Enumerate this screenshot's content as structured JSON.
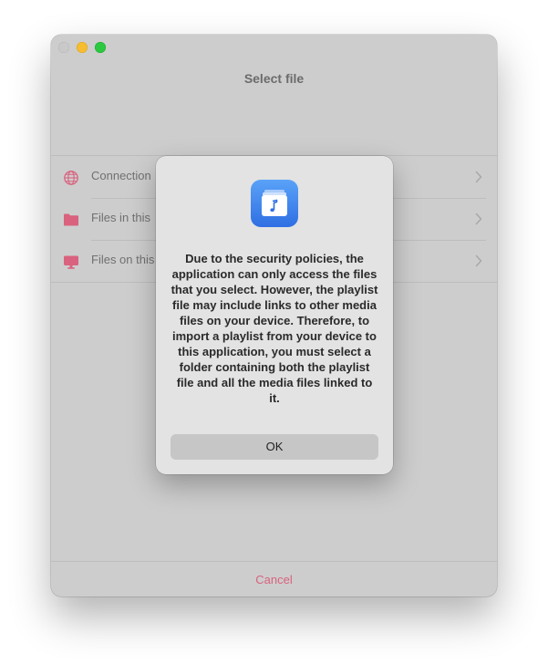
{
  "window": {
    "title": "Select file"
  },
  "list": {
    "items": [
      {
        "icon": "globe-icon",
        "label": "Connection"
      },
      {
        "icon": "folder-icon",
        "label": "Files in this"
      },
      {
        "icon": "monitor-icon",
        "label": "Files on this"
      }
    ]
  },
  "footer": {
    "cancel_label": "Cancel"
  },
  "alert": {
    "icon": "music-file-app-icon",
    "message": "Due to the security policies, the application can only access the files that you select. However, the playlist file may include links to other media files on your device. Therefore, to import a playlist from your device to this application, you must select a folder containing both the playlist file and all the media files linked to it.",
    "ok_label": "OK"
  },
  "colors": {
    "accent": "#d9627e",
    "folder": "#d9627e",
    "alert_icon": "#3b82f6"
  }
}
